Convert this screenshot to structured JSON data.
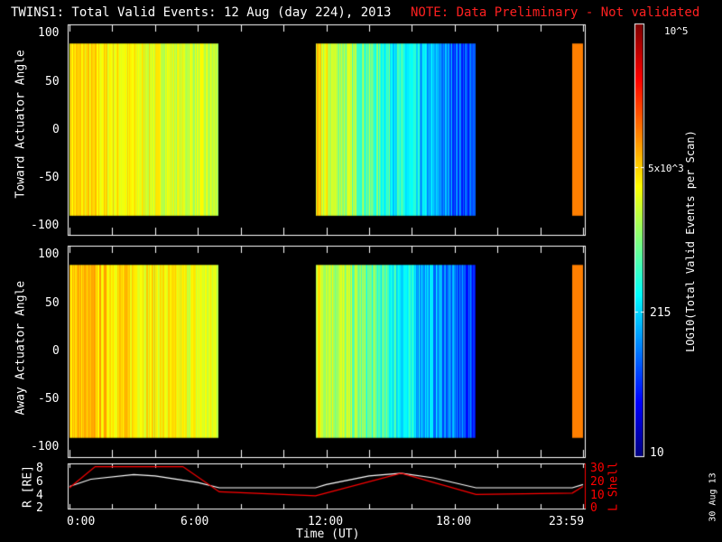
{
  "header": {
    "title": "TWINS1: Total Valid Events: 12 Aug (day 224), 2013",
    "note": "NOTE: Data Preliminary - Not validated"
  },
  "footer_date": "30 Aug 13",
  "chart_data": [
    {
      "type": "heatmap",
      "title": "Toward Actuator Angle",
      "ylabel": "Toward Actuator Angle",
      "ylim": [
        -110,
        110
      ],
      "yticks": [
        "100",
        "50",
        "0",
        "-50",
        "-100"
      ],
      "data_yrange": [
        -90,
        90
      ],
      "segments_hours": [
        [
          0,
          6.95,
          "high"
        ],
        [
          11.5,
          19,
          "decreasing"
        ],
        [
          23.5,
          24,
          "very-high"
        ]
      ]
    },
    {
      "type": "heatmap",
      "title": "Away Actuator Angle",
      "ylabel": "Away Actuator Angle",
      "ylim": [
        -110,
        110
      ],
      "yticks": [
        "100",
        "50",
        "0",
        "-50",
        "-100"
      ],
      "data_yrange": [
        -90,
        90
      ],
      "segments_hours": [
        [
          0,
          6.95,
          "high"
        ],
        [
          11.5,
          19,
          "decreasing"
        ],
        [
          23.5,
          24,
          "very-high"
        ]
      ]
    },
    {
      "type": "line",
      "xlabel": "Time (UT)",
      "xticks": [
        "0:00",
        "6:00",
        "12:00",
        "18:00",
        "23:59"
      ],
      "ylabel_left": "R [RE]",
      "ylim_left": [
        2,
        8
      ],
      "yticks_left": [
        "8",
        "6",
        "4",
        "2"
      ],
      "ylabel_right": "L Shell",
      "ylim_right": [
        0,
        30
      ],
      "yticks_right": [
        "30",
        "20",
        "10",
        "0"
      ],
      "series": [
        {
          "name": "R",
          "color": "#ffffff",
          "x": [
            0,
            1,
            3,
            4,
            6,
            7,
            11.5,
            12,
            14,
            15.5,
            17,
            19,
            23.5,
            24
          ],
          "y": [
            5.2,
            6.3,
            7,
            6.8,
            5.8,
            5,
            5,
            5.5,
            6.8,
            7.2,
            6.5,
            5,
            5,
            5.5
          ]
        },
        {
          "name": "L Shell",
          "color": "#ff0000",
          "x": [
            0,
            1.2,
            5.3,
            7,
            11.5,
            15.5,
            19,
            23.5,
            24
          ],
          "y": [
            15,
            31,
            31,
            12,
            9,
            26,
            10,
            11,
            16
          ]
        }
      ]
    },
    {
      "type": "colorbar",
      "label": "LOG10(Total Valid Events per Scan)",
      "ticks": [
        "10^5",
        "5x10^3",
        "215",
        "10"
      ],
      "tick_values": [
        100000,
        5000,
        215,
        10
      ]
    }
  ]
}
